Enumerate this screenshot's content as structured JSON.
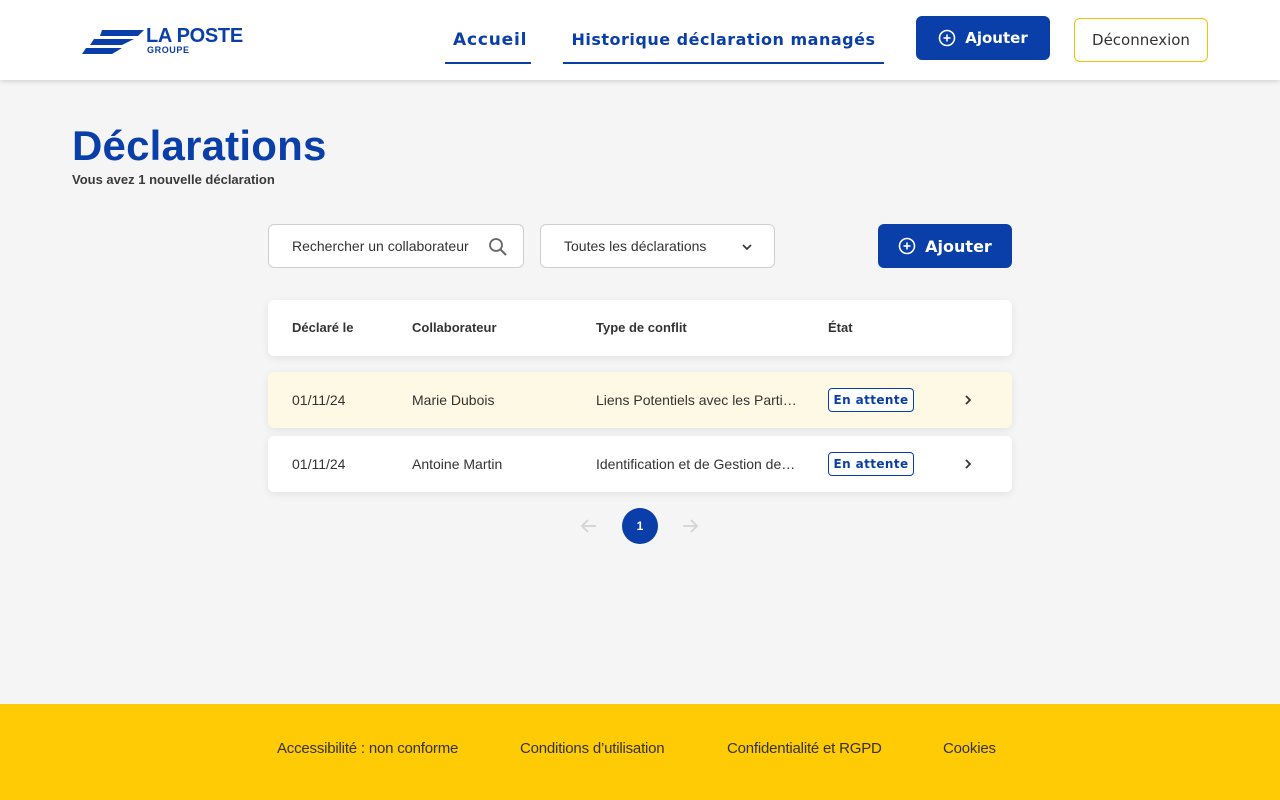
{
  "brand": {
    "name": "LA POSTE",
    "sub": "GROUPE",
    "color": "#0a3ea8"
  },
  "nav": {
    "home_label": "Accueil",
    "history_label": "Historique déclaration managés",
    "add_label": "Ajouter",
    "logout_label": "Déconnexion"
  },
  "page": {
    "title": "Déclarations",
    "subtitle": "Vous avez 1 nouvelle déclaration"
  },
  "toolbar": {
    "search_placeholder": "Rechercher un collaborateur",
    "filter_value": "Toutes les déclarations",
    "add_label": "Ajouter"
  },
  "table": {
    "headers": [
      "Déclaré le",
      "Collaborateur",
      "Type de conflit",
      "État"
    ],
    "rows": [
      {
        "date": "01/11/24",
        "collaborator": "Marie Dubois",
        "conflict": "Liens Potentiels avec les Parties Prenantes",
        "status": "En attente",
        "highlighted": true
      },
      {
        "date": "01/11/24",
        "collaborator": "Antoine Martin",
        "conflict": "Identification et de Gestion des Conflits",
        "status": "En attente",
        "highlighted": false
      }
    ]
  },
  "pagination": {
    "current": "1"
  },
  "footer": {
    "links": [
      "Accessibilité : non conforme",
      "Conditions d’utilisation",
      "Confidentialité et RGPD",
      "Cookies"
    ]
  },
  "colors": {
    "primary": "#0a3ea8",
    "footer": "#ffcb05",
    "highlight_row": "#fef9e4",
    "logout_border": "#f0c400"
  }
}
